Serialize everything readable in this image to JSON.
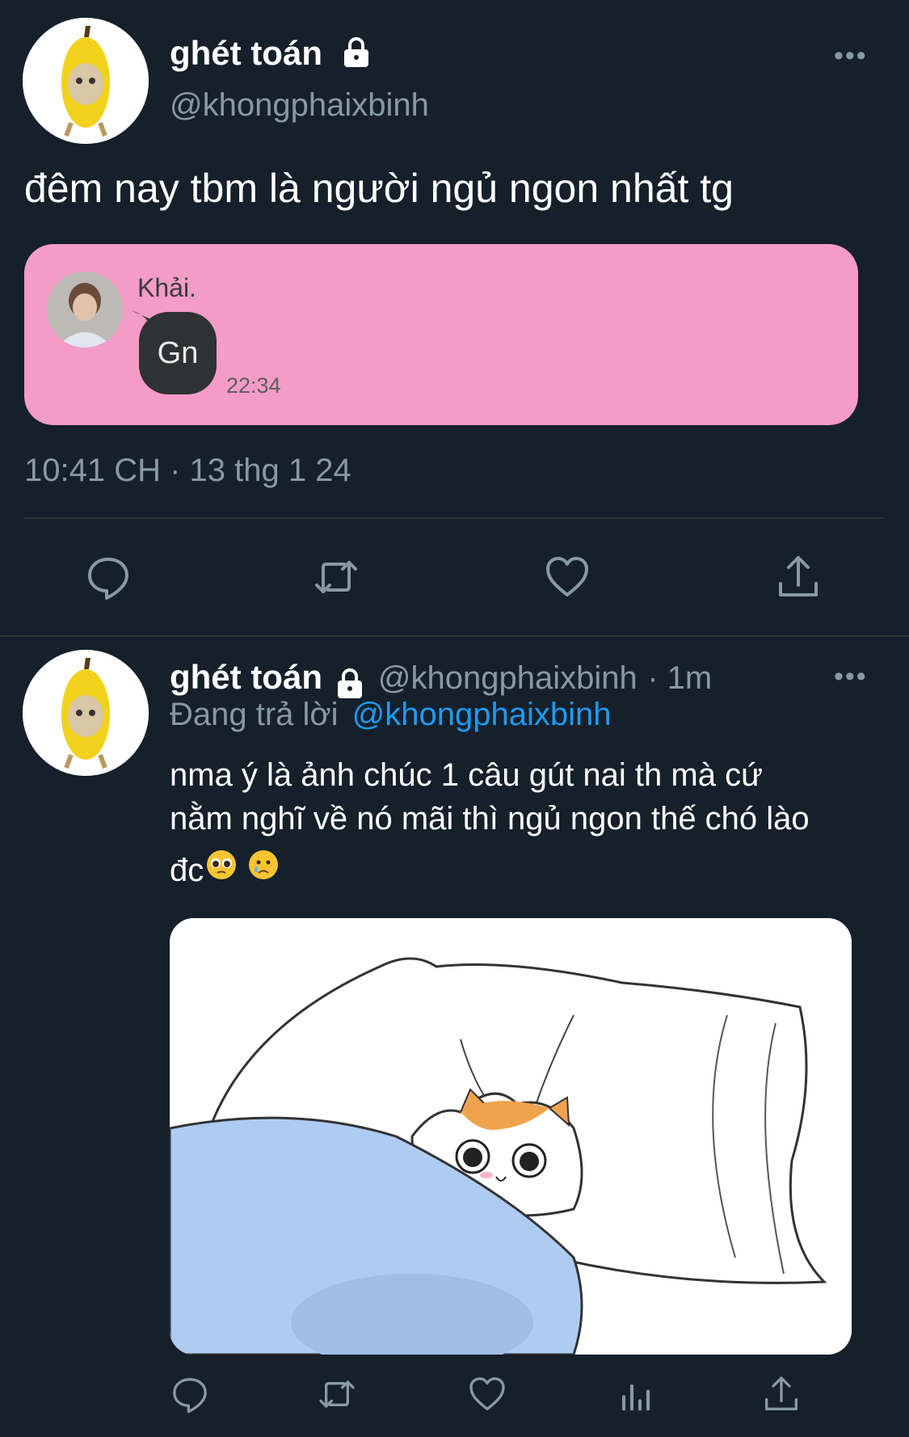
{
  "main_tweet": {
    "display_name": "ghét toán",
    "handle": "@khongphaixbinh",
    "text": "đêm nay tbm là người ngủ ngon nhất tg",
    "timestamp": "10:41 CH · 13 thg 1 24",
    "embedded_chat": {
      "sender_name": "Khải.",
      "message": "Gn",
      "time": "22:34",
      "card_color": "#f29cc6",
      "bubble_color": "#2f3133"
    }
  },
  "reply_tweet": {
    "display_name": "ghét toán",
    "handle": "@khongphaixbinh",
    "time_ago": "· 1m",
    "replying_to_label": "Đang trả lời",
    "replying_to_handle": "@khongphaixbinh",
    "text_line1": "nma ý là ảnh chúc 1 câu gút nai th mà cứ",
    "text_line2": "nằm nghĩ về nó mãi thì ngủ ngon thế chó lào",
    "text_line3": "đc",
    "emojis": [
      "pleading-face",
      "crying-face"
    ]
  },
  "icons": {
    "more": "more-dots-icon",
    "lock": "lock-icon",
    "reply": "reply-icon",
    "retweet": "retweet-icon",
    "like": "heart-icon",
    "share": "share-icon",
    "analytics": "analytics-icon"
  },
  "colors": {
    "background": "#15202b",
    "muted_text": "#8899a6",
    "link": "#1d9bf0",
    "divider": "#2f3336"
  }
}
